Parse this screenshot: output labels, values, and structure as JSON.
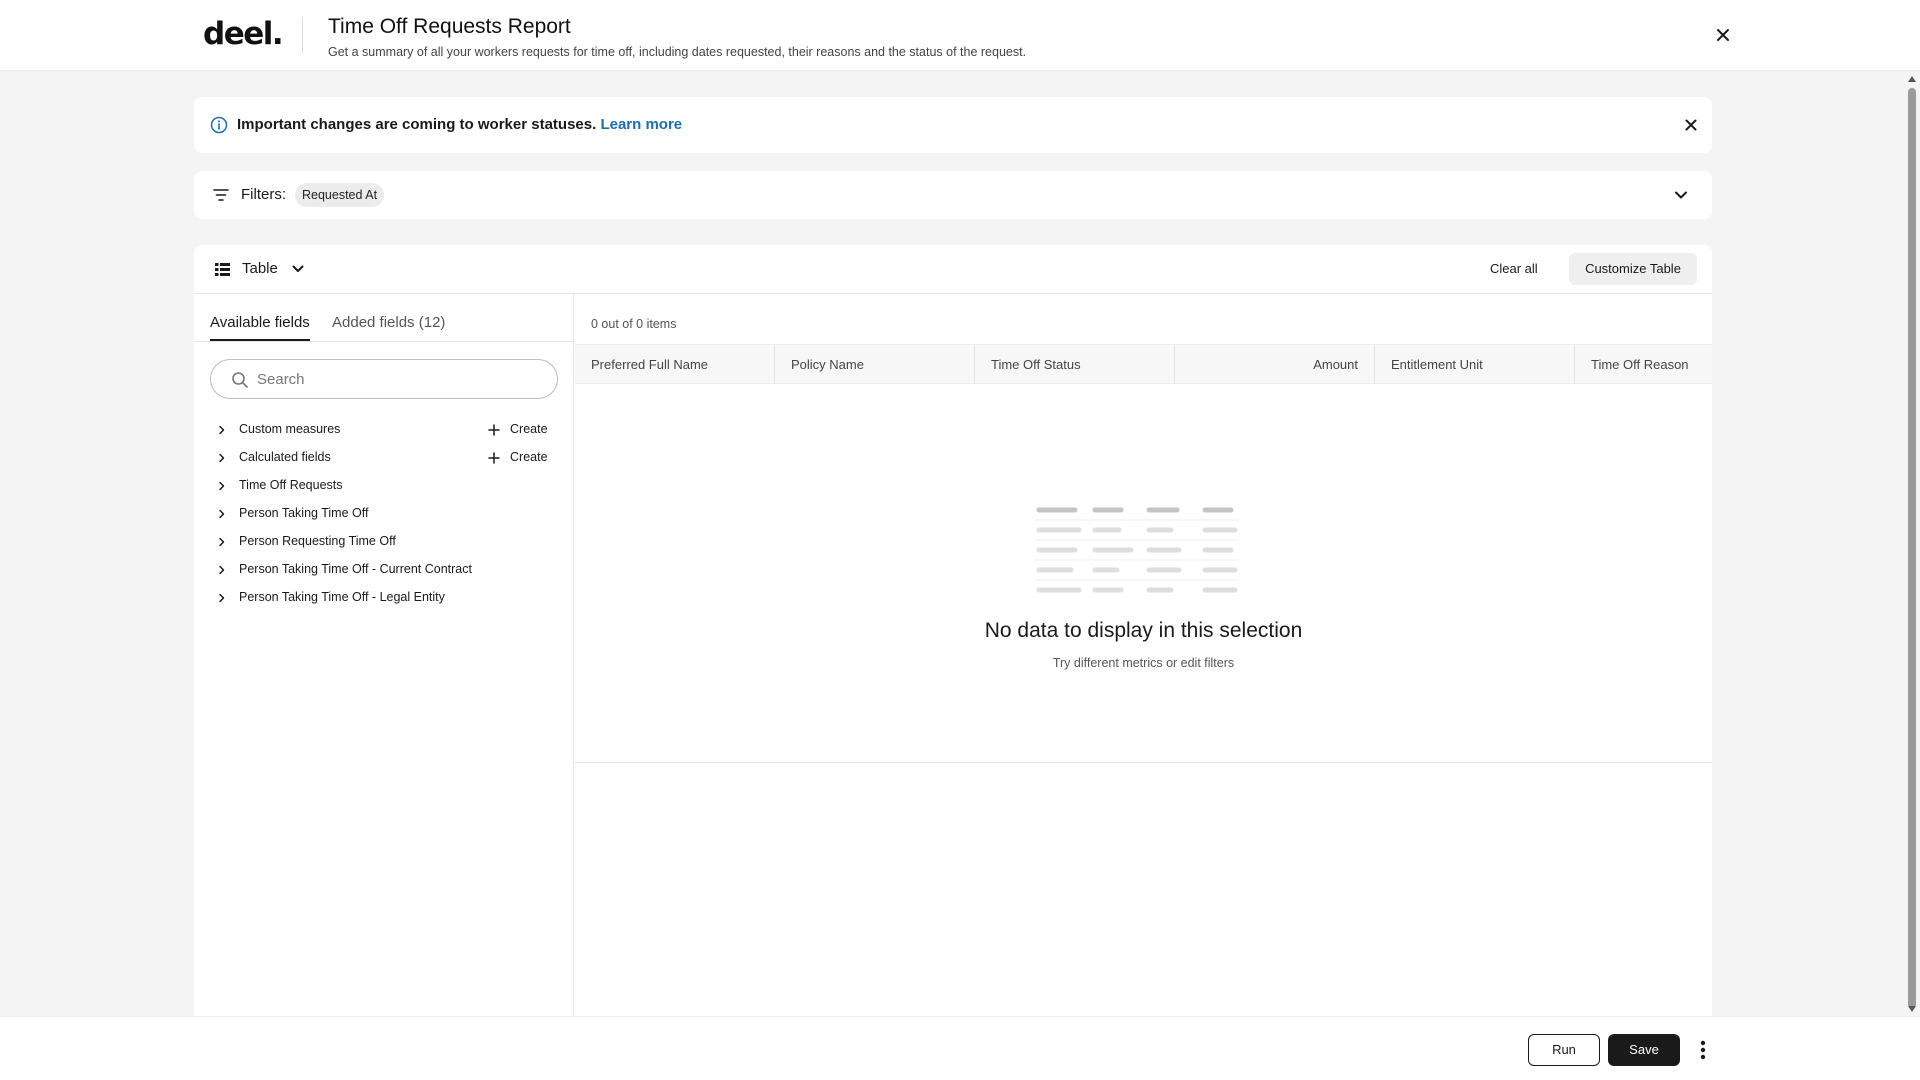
{
  "header": {
    "logo": "deel.",
    "title": "Time Off Requests Report",
    "subtitle": "Get a summary of all your workers requests for time off, including dates requested, their reasons and the status of the request.",
    "close_icon": "close-icon"
  },
  "banner": {
    "icon": "info-icon",
    "text": "Important changes are coming to worker statuses.",
    "link": "Learn more",
    "close_icon": "close-icon"
  },
  "filters": {
    "icon": "filter-icon",
    "label": "Filters:",
    "chips": [
      "Requested At"
    ],
    "expand_icon": "chevron-down-icon"
  },
  "toolbar": {
    "view_icon": "table-icon",
    "view_label": "Table",
    "clear_all": "Clear all",
    "customize": "Customize Table"
  },
  "left_panel": {
    "tabs": [
      {
        "label": "Available fields",
        "active": true
      },
      {
        "label": "Added fields (12)",
        "active": false
      }
    ],
    "search": {
      "placeholder": "Search",
      "value": ""
    },
    "fields": [
      {
        "label": "Custom measures",
        "action": "Create"
      },
      {
        "label": "Calculated fields",
        "action": "Create"
      },
      {
        "label": "Time Off Requests"
      },
      {
        "label": "Person Taking Time Off"
      },
      {
        "label": "Person Requesting Time Off"
      },
      {
        "label": "Person Taking Time Off - Current Contract"
      },
      {
        "label": "Person Taking Time Off - Legal Entity"
      }
    ]
  },
  "table": {
    "count": "0 out of 0 items",
    "columns": [
      "Preferred Full Name",
      "Policy Name",
      "Time Off Status",
      "Amount",
      "Entitlement Unit",
      "Time Off Reason"
    ],
    "rows": [],
    "empty_title": "No data to display in this selection",
    "empty_subtitle": "Try different metrics or edit filters"
  },
  "footer": {
    "run": "Run",
    "save": "Save",
    "more_icon": "more-vertical-icon"
  },
  "colors": {
    "link": "#1a6fb3",
    "primary_button": "#1a1a1a",
    "page_background": "#f4f4f4"
  }
}
